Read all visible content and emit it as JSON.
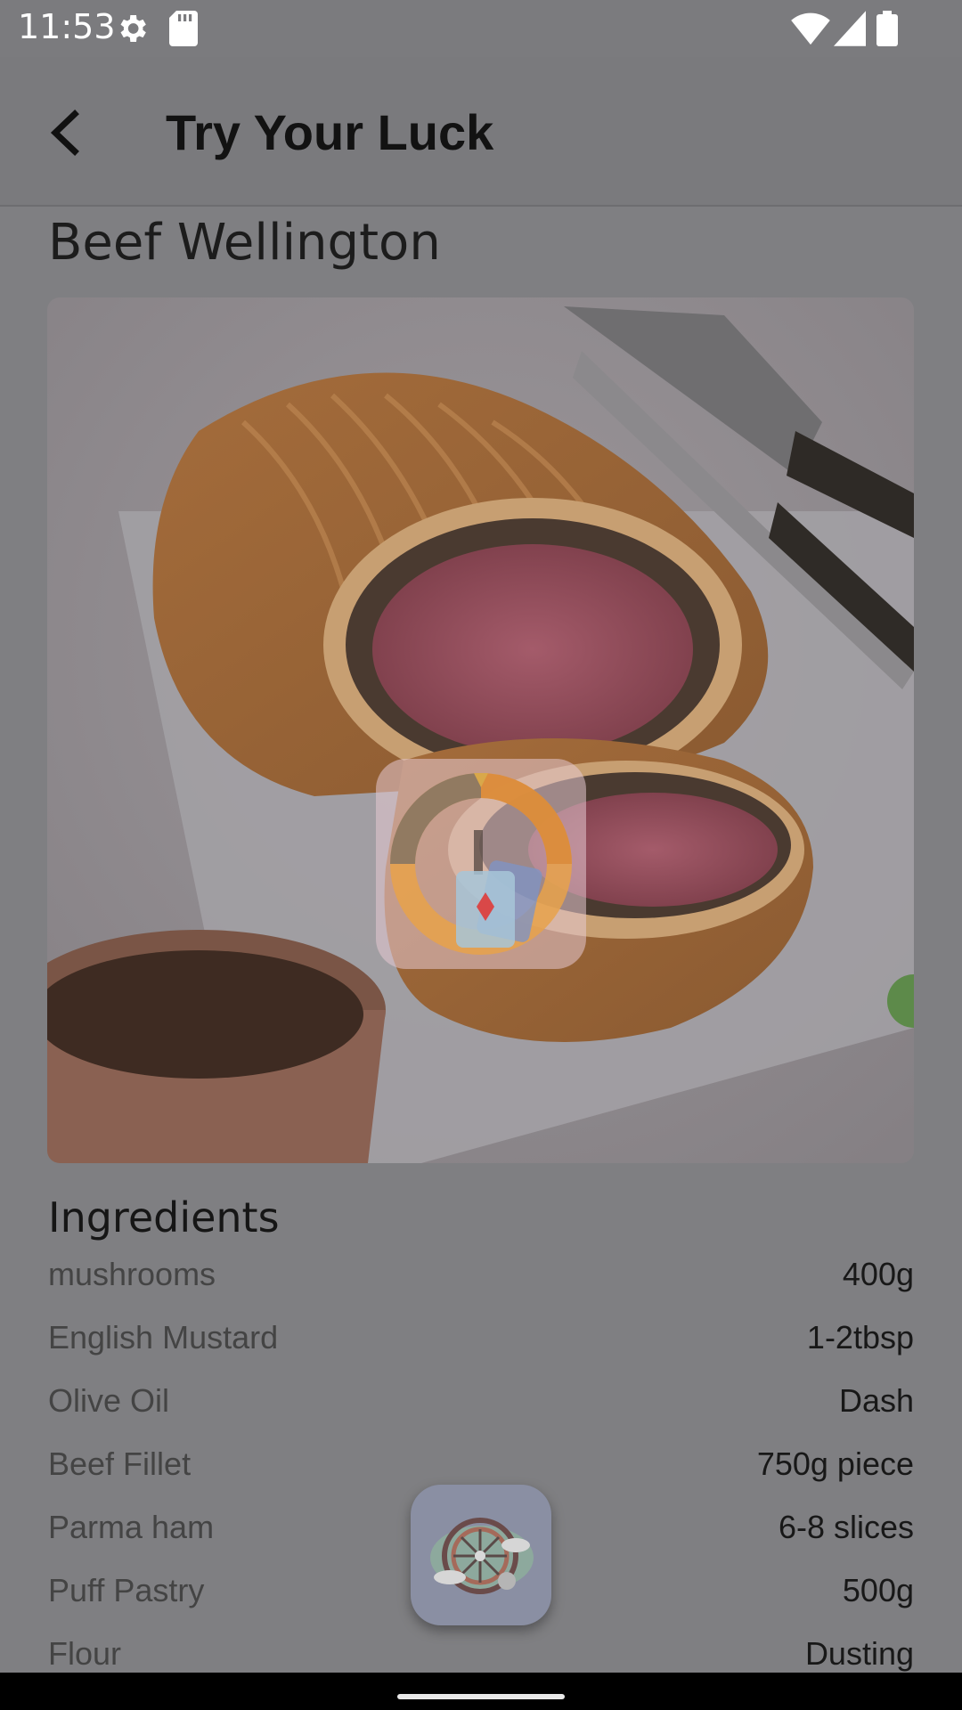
{
  "status_bar": {
    "time": "11:53",
    "icons": [
      "settings-icon",
      "sd-card-icon",
      "wifi-icon",
      "signal-icon",
      "battery-icon"
    ]
  },
  "app_bar": {
    "title": "Try Your Luck",
    "back_icon": "arrow-back-icon"
  },
  "recipe": {
    "title": "Beef Wellington",
    "image_alt": "Sliced beef wellington on a platter with gravy and carving knife",
    "ingredients_heading": "Ingredients",
    "ingredients": [
      {
        "name": "mushrooms",
        "qty": "400g"
      },
      {
        "name": "English Mustard",
        "qty": "1-2tbsp"
      },
      {
        "name": "Olive Oil",
        "qty": "Dash"
      },
      {
        "name": "Beef Fillet",
        "qty": "750g piece"
      },
      {
        "name": "Parma ham",
        "qty": "6-8 slices"
      },
      {
        "name": "Puff Pastry",
        "qty": "500g"
      },
      {
        "name": "Flour",
        "qty": "Dusting"
      }
    ]
  },
  "overlay": {
    "logo_icon": "spin-wheel-cards-logo-icon"
  },
  "fab": {
    "icon": "wheel-of-fortune-icon"
  },
  "colors": {
    "scrim": "#7f7f82",
    "text_dark": "#161616",
    "text_muted": "#444444"
  }
}
